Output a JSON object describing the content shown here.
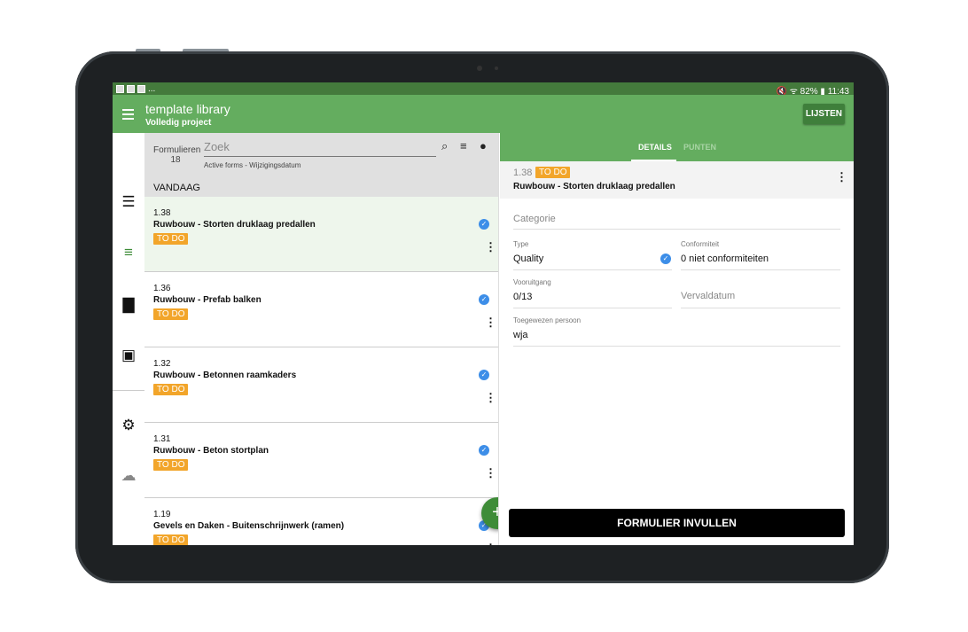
{
  "status": {
    "app_dots": "...",
    "right": "🔇 ᯤ 82% ▮ 11:43"
  },
  "appbar": {
    "title": "template library",
    "subtitle": "Volledig project",
    "lijsten": "LIJSTEN"
  },
  "list": {
    "label": "Formulieren",
    "count": "18",
    "search_placeholder": "Zoek",
    "meta": "Active forms  -  Wijzigingsdatum",
    "section": "VANDAAG",
    "items": [
      {
        "number": "1.38",
        "title": "Ruwbouw - Storten druklaag predallen",
        "status": "TO DO"
      },
      {
        "number": "1.36",
        "title": "Ruwbouw - Prefab balken",
        "status": "TO DO"
      },
      {
        "number": "1.32",
        "title": "Ruwbouw - Betonnen raamkaders",
        "status": "TO DO"
      },
      {
        "number": "1.31",
        "title": "Ruwbouw - Beton stortplan",
        "status": "TO DO"
      },
      {
        "number": "1.19",
        "title": "Gevels en Daken - Buitenschrijnwerk (ramen)",
        "status": "TO DO"
      }
    ]
  },
  "detail": {
    "tabs": [
      "DETAILS",
      "PUNTEN"
    ],
    "number": "1.38",
    "status": "TO DO",
    "title": "Ruwbouw - Storten druklaag predallen",
    "categorie_placeholder": "Categorie",
    "type_label": "Type",
    "type_value": "Quality",
    "conf_label": "Conformiteit",
    "conf_value": "0 niet conformiteiten",
    "voor_label": "Vooruitgang",
    "voor_value": "0/13",
    "verval_placeholder": "Vervaldatum",
    "persoon_label": "Toegewezen persoon",
    "persoon_value": "wja",
    "fill_button": "FORMULIER INVULLEN"
  },
  "colors": {
    "primary": "#64ad5f",
    "status_bar": "#447a3c",
    "todo": "#f2a52a",
    "check": "#3d8ee8"
  }
}
